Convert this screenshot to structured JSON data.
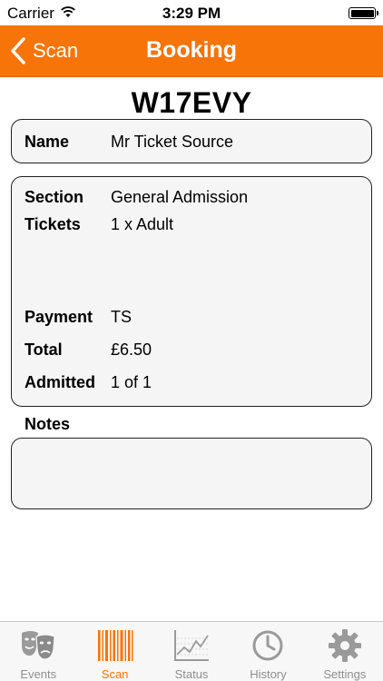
{
  "status_bar": {
    "carrier": "Carrier",
    "time": "3:29 PM"
  },
  "nav": {
    "back_label": "Scan",
    "title": "Booking"
  },
  "booking": {
    "reference": "W17EVY",
    "name_label": "Name",
    "name_value": "Mr Ticket Source",
    "section_label": "Section",
    "section_value": "General Admission",
    "tickets_label": "Tickets",
    "tickets_value": "1 x Adult",
    "payment_label": "Payment",
    "payment_value": "TS",
    "total_label": "Total",
    "total_value": "£6.50",
    "admitted_label": "Admitted",
    "admitted_value": "1 of 1",
    "notes_label": "Notes",
    "notes_value": ""
  },
  "tabs": [
    {
      "label": "Events",
      "icon": "theatre-masks-icon",
      "active": false
    },
    {
      "label": "Scan",
      "icon": "barcode-icon",
      "active": true
    },
    {
      "label": "Status",
      "icon": "line-chart-icon",
      "active": false
    },
    {
      "label": "History",
      "icon": "clock-icon",
      "active": false
    },
    {
      "label": "Settings",
      "icon": "gear-icon",
      "active": false
    }
  ],
  "colors": {
    "accent": "#f77408",
    "inactive_tab": "#8e8e8e"
  }
}
